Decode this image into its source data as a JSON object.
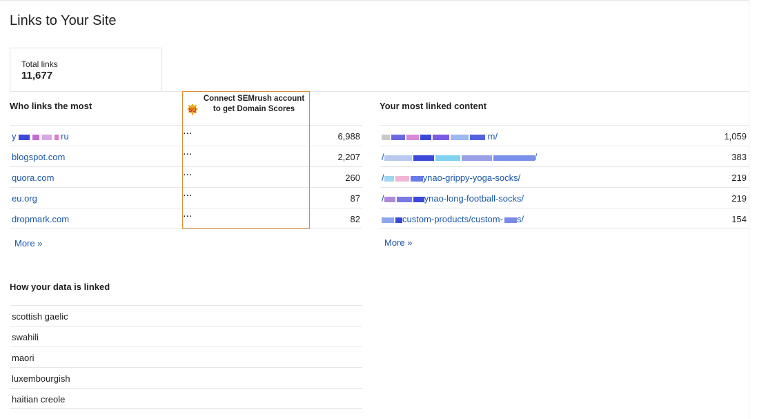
{
  "page": {
    "title": "Links to Your Site"
  },
  "total_links": {
    "label": "Total links",
    "value": "11,677"
  },
  "who_links": {
    "heading": "Who links the most",
    "rows": [
      {
        "name": "y              ru",
        "count": "6,988",
        "domain_score": "..."
      },
      {
        "name": "blogspot.com",
        "count": "2,207",
        "domain_score": "..."
      },
      {
        "name": "quora.com",
        "count": "260",
        "domain_score": "..."
      },
      {
        "name": "eu.org",
        "count": "87",
        "domain_score": "..."
      },
      {
        "name": "dropmark.com",
        "count": "82",
        "domain_score": "..."
      }
    ],
    "more": "More »"
  },
  "semrush": {
    "text": "Connect SEMrush account to get Domain Scores",
    "icon": "semrush-logo-icon"
  },
  "linked_content": {
    "heading": "Your most linked content",
    "rows": [
      {
        "url": "                       m/",
        "count": "1,059"
      },
      {
        "url": "                              /",
        "count": "383"
      },
      {
        "url": "/   ynao-grippy-yoga-socks/",
        "count": "219"
      },
      {
        "url": "/    ynao-long-football-socks/",
        "count": "219"
      },
      {
        "url": "        custom-products/custom-   s/",
        "count": "154"
      }
    ],
    "more": "More »"
  },
  "how_linked": {
    "heading": "How your data is linked",
    "rows": [
      "scottish gaelic",
      "swahili",
      "maori",
      "luxembourgish",
      "haitian creole"
    ]
  },
  "colors": {
    "link": "#1a56a8",
    "semrush_border": "#e08a3c",
    "divider": "#e6e6e6"
  }
}
